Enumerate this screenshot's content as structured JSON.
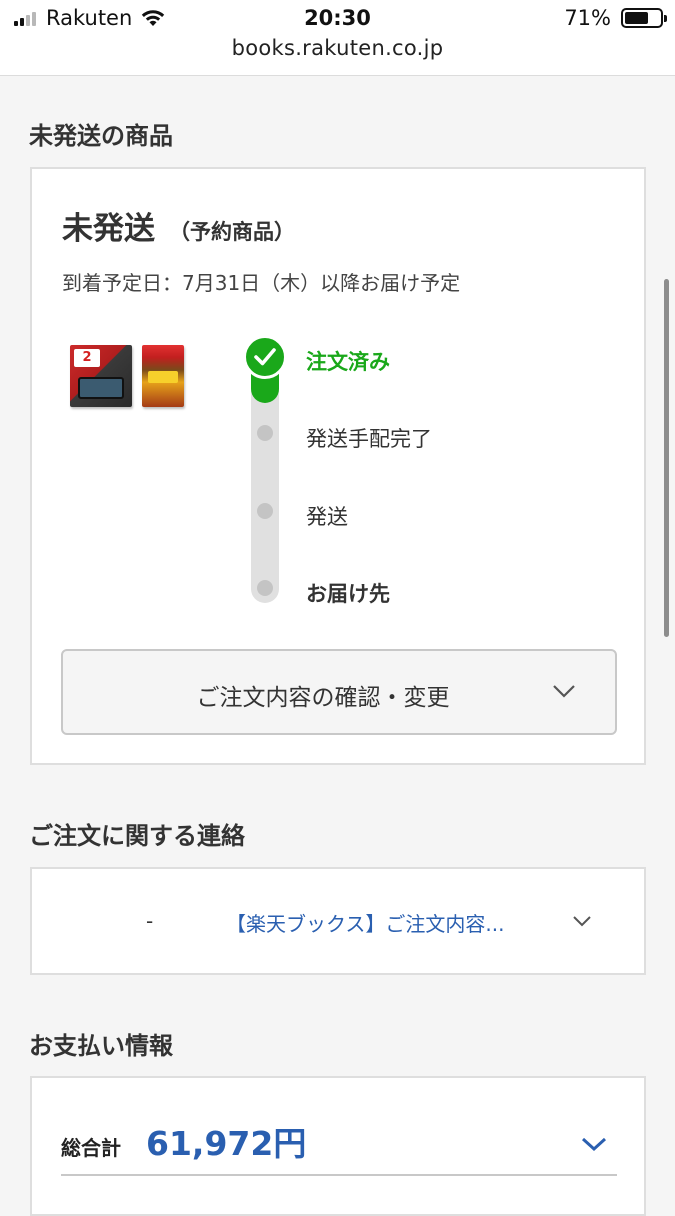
{
  "status_bar": {
    "carrier": "Rakuten",
    "time": "20:30",
    "battery": "71%",
    "battery_level": 0.71,
    "url": "books.rakuten.co.jp"
  },
  "unshipped_section": {
    "title": "未発送の商品",
    "status": "未発送",
    "status_note": "（予約商品）",
    "arrival": "到着予定日：7月31日（木）以降お届け予定",
    "items": [
      "switch-2-console",
      "game-software"
    ],
    "steps": [
      {
        "label": "注文済み",
        "state": "done"
      },
      {
        "label": "発送手配完了",
        "state": "pending"
      },
      {
        "label": "発送",
        "state": "pending"
      },
      {
        "label": "お届け先",
        "state": "pending"
      }
    ],
    "confirm_button": "ご注文内容の確認・変更"
  },
  "contact_section": {
    "title": "ご注文に関する連絡",
    "date": "-",
    "message": "【楽天ブックス】ご注文内容..."
  },
  "payment_section": {
    "title": "お支払い情報",
    "total_label": "総合計",
    "total_value": "61,972円"
  },
  "colors": {
    "accent_green": "#1aa81a",
    "link_blue": "#2a5fb0"
  }
}
